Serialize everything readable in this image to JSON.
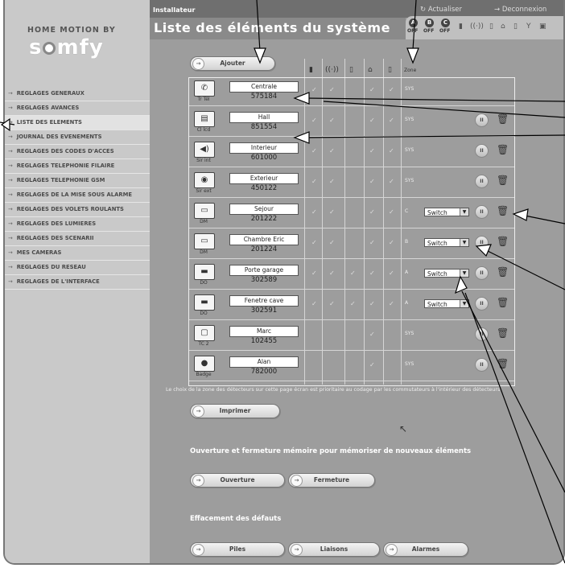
{
  "brand": {
    "tagline": "HOME MOTION BY",
    "logo_letters": [
      "s",
      "mfy"
    ]
  },
  "header": {
    "installer": "Installateur",
    "page_title": "Liste des éléments du système",
    "refresh": "Actualiser",
    "logout": "Deconnexion"
  },
  "status": {
    "labels": [
      "OFF",
      "OFF",
      "OFF"
    ],
    "circles": [
      "A",
      "B",
      "C"
    ]
  },
  "menu": [
    {
      "label": "REGLAGES GENERAUX",
      "active": false
    },
    {
      "label": "REGLAGES AVANCES",
      "active": false
    },
    {
      "label": "LISTE DES ELEMENTS",
      "active": true
    },
    {
      "label": "JOURNAL DES EVENEMENTS",
      "active": false
    },
    {
      "label": "REGLAGES DES CODES D'ACCES",
      "active": false
    },
    {
      "label": "REGLAGES TELEPHONIE FILAIRE",
      "active": false
    },
    {
      "label": "REGLAGES TELEPHONIE GSM",
      "active": false
    },
    {
      "label": "REGLAGES DE LA MISE SOUS ALARME",
      "active": false
    },
    {
      "label": "REGLAGES DES VOLETS ROULANTS",
      "active": false
    },
    {
      "label": "REGLAGES DES LUMIERES",
      "active": false
    },
    {
      "label": "REGLAGES DES SCENARII",
      "active": false
    },
    {
      "label": "MES CAMERAS",
      "active": false
    },
    {
      "label": "REGLAGES DU RESEAU",
      "active": false
    },
    {
      "label": "REGLAGES DE L'INTERFACE",
      "active": false
    }
  ],
  "buttons": {
    "add": "Ajouter",
    "print": "Imprimer",
    "open": "Ouverture",
    "close": "Fermeture",
    "batteries": "Piles",
    "links": "Liaisons",
    "alarms": "Alarmes"
  },
  "table": {
    "zone_header": "Zone"
  },
  "devices": [
    {
      "name": "Centrale",
      "code": "575184",
      "type": "Tr Tél",
      "icon": "phone-icon",
      "checks": [
        1,
        1,
        0,
        1,
        1
      ],
      "zone": "SYS",
      "select": "",
      "controls": false
    },
    {
      "name": "Hall",
      "code": "851554",
      "type": "Cl lcd",
      "icon": "keypad-icon",
      "checks": [
        1,
        1,
        0,
        1,
        1
      ],
      "zone": "SYS",
      "select": "",
      "controls": true
    },
    {
      "name": "Interieur",
      "code": "601000",
      "type": "Sir int",
      "icon": "siren-icon",
      "checks": [
        1,
        1,
        0,
        1,
        1
      ],
      "zone": "SYS",
      "select": "",
      "controls": true
    },
    {
      "name": "Exterieur",
      "code": "450122",
      "type": "Sir ext",
      "icon": "outdoor-siren-icon",
      "checks": [
        1,
        1,
        0,
        1,
        1
      ],
      "zone": "SYS",
      "select": "",
      "controls": true
    },
    {
      "name": "Sejour",
      "code": "201222",
      "type": "DM",
      "icon": "motion-detector-icon",
      "checks": [
        1,
        1,
        0,
        1,
        1
      ],
      "zone": "C",
      "select": "Switch",
      "controls": true
    },
    {
      "name": "Chambre Eric",
      "code": "201224",
      "type": "DM",
      "icon": "motion-detector-icon",
      "checks": [
        1,
        1,
        0,
        1,
        1
      ],
      "zone": "B",
      "select": "Switch",
      "controls": true
    },
    {
      "name": "Porte garage",
      "code": "302589",
      "type": "DO",
      "icon": "opening-detector-icon",
      "checks": [
        1,
        1,
        1,
        1,
        1
      ],
      "zone": "A",
      "select": "Switch",
      "controls": true
    },
    {
      "name": "Fenetre cave",
      "code": "302591",
      "type": "DO",
      "icon": "opening-detector-icon",
      "checks": [
        1,
        1,
        1,
        1,
        1
      ],
      "zone": "A",
      "select": "Switch",
      "controls": true
    },
    {
      "name": "Marc",
      "code": "102455",
      "type": "TC 2",
      "icon": "remote-icon",
      "checks": [
        0,
        0,
        0,
        1,
        0
      ],
      "zone": "SYS",
      "select": "",
      "controls": true
    },
    {
      "name": "Alan",
      "code": "782000",
      "type": "Badge",
      "icon": "badge-icon",
      "checks": [
        0,
        0,
        0,
        1,
        0
      ],
      "zone": "SYS",
      "select": "",
      "controls": true
    }
  ],
  "note": "Le choix de la zone des détecteurs sur cette page écran est prioritaire au codage par les commutateurs à l'intérieur des détecteurs",
  "sections": {
    "memory": "Ouverture et fermeture mémoire pour mémoriser de nouveaux éléments",
    "faults": "Effacement des défauts"
  }
}
